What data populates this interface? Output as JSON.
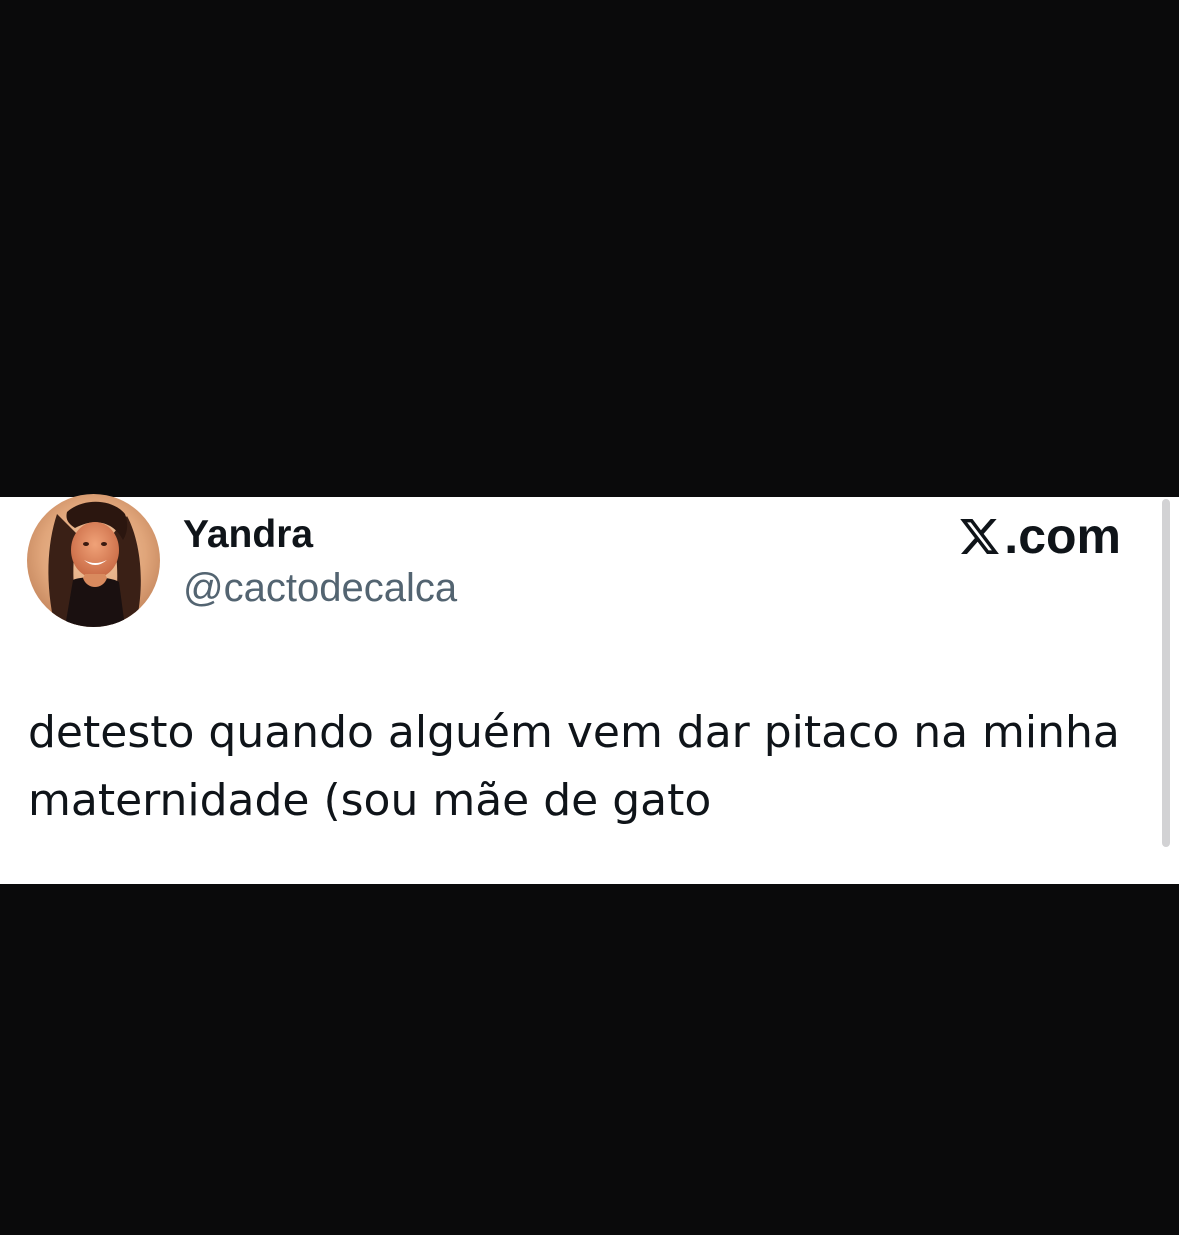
{
  "tweet": {
    "display_name": "Yandra",
    "handle": "@cactodecalca",
    "brand": {
      "icon": "x-logo-icon",
      "text": ".com"
    },
    "text_lines": [
      "detesto quando alguém vem dar pitaco na minha",
      "maternidade (sou mãe de gato"
    ]
  },
  "colors": {
    "background": "#0a0a0b",
    "card": "#ffffff",
    "text_primary": "#0f1419",
    "text_secondary": "#536471"
  }
}
